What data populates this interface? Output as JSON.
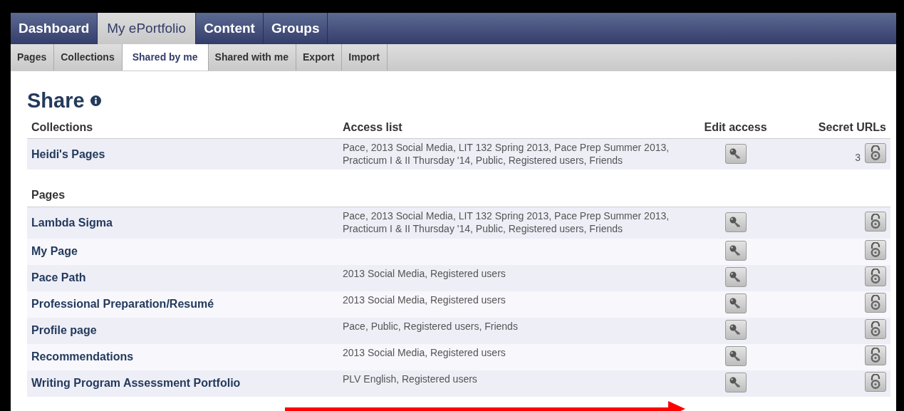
{
  "main_nav": [
    {
      "label": "Dashboard",
      "selected": false
    },
    {
      "label": "My ePortfolio",
      "selected": true
    },
    {
      "label": "Content",
      "selected": false
    },
    {
      "label": "Groups",
      "selected": false
    }
  ],
  "sub_nav": [
    {
      "label": "Pages",
      "selected": false
    },
    {
      "label": "Collections",
      "selected": false
    },
    {
      "label": "Shared by me",
      "selected": true
    },
    {
      "label": "Shared with me",
      "selected": false
    },
    {
      "label": "Export",
      "selected": false
    },
    {
      "label": "Import",
      "selected": false
    }
  ],
  "heading": "Share",
  "table": {
    "columns": [
      "Collections",
      "Access list",
      "Edit access",
      "Secret URLs"
    ],
    "sections": [
      {
        "rows": [
          {
            "name": "Heidi's Pages",
            "access": "Pace, 2013 Social Media, LIT 132 Spring 2013, Pace Prep Summer 2013, Practicum I & II Thursday '14, Public, Registered users, Friends",
            "secret_count": "3"
          }
        ]
      },
      {
        "title": "Pages",
        "rows": [
          {
            "name": "Lambda Sigma",
            "access": "Pace, 2013 Social Media, LIT 132 Spring 2013, Pace Prep Summer 2013, Practicum I & II Thursday '14, Public, Registered users, Friends"
          },
          {
            "name": "My Page"
          },
          {
            "name": "Pace Path",
            "access": "2013 Social Media, Registered users"
          },
          {
            "name": "Professional Preparation/Resumé",
            "access": "2013 Social Media, Registered users"
          },
          {
            "name": "Profile page",
            "access": "Pace, Public, Registered users, Friends"
          },
          {
            "name": "Recommendations",
            "access": "2013 Social Media, Registered users"
          },
          {
            "name": "Writing Program Assessment Portfolio",
            "access": "PLV English, Registered users"
          }
        ]
      }
    ]
  },
  "annotation": {
    "kind": "arrow"
  }
}
